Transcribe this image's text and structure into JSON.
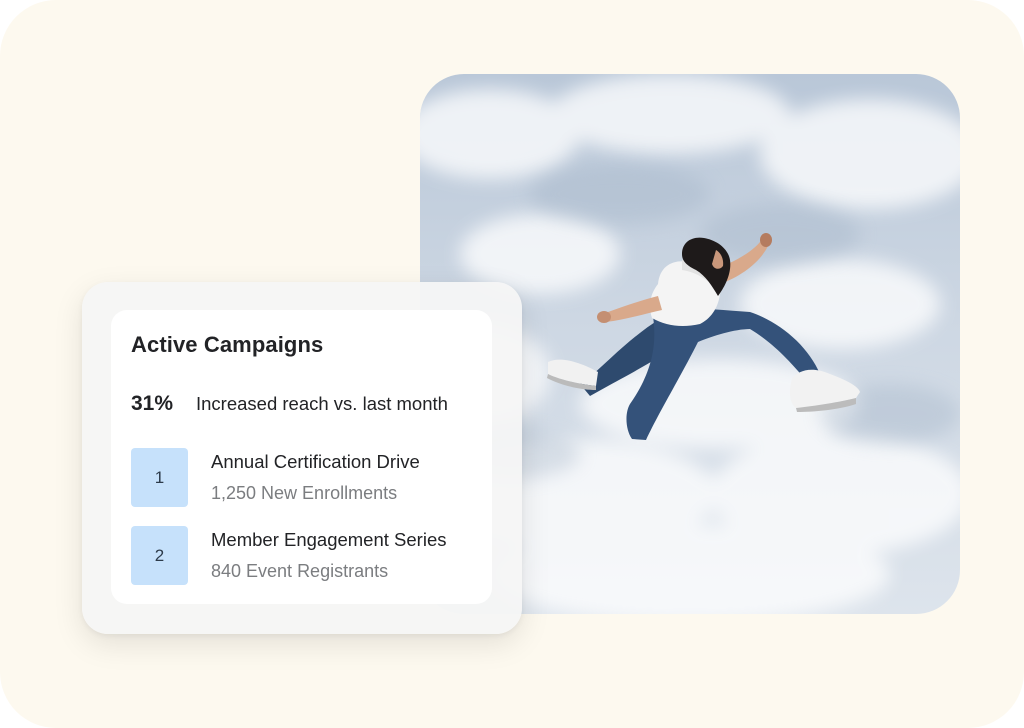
{
  "card": {
    "title": "Active Campaigns",
    "metric": {
      "value": "31%",
      "label": "Increased reach vs. last month"
    },
    "campaigns": [
      {
        "rank": "1",
        "name": "Annual Certification Drive",
        "detail": "1,250 New Enrollments"
      },
      {
        "rank": "2",
        "name": "Member Engagement Series",
        "detail": "840 Event Registrants"
      }
    ]
  },
  "colors": {
    "background": "#fdf9ef",
    "badge": "#c6e1fb",
    "text_primary": "#222326",
    "text_secondary": "#7b7d80",
    "sky": "#c9d4e2"
  },
  "photo": {
    "subject": "person-jumping-against-cloudy-sky"
  }
}
